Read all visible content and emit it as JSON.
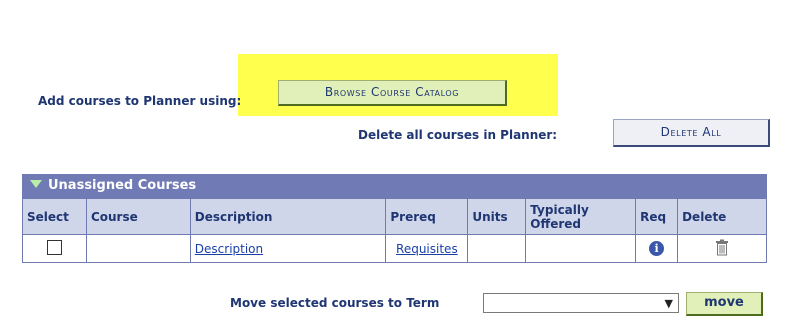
{
  "add_label": "Add courses to Planner using:",
  "browse_button": "Browse Course Catalog",
  "delete_label": "Delete all courses in Planner:",
  "delete_all_button": "Delete All",
  "grid": {
    "title": "Unassigned Courses",
    "columns": [
      "Select",
      "Course",
      "Description",
      "Prereq",
      "Units",
      "Typically Offered",
      "Req",
      "Delete"
    ],
    "rows": [
      {
        "select": false,
        "course": "",
        "description": "Description",
        "prereq": "Requisites",
        "units": "",
        "typically_offered": "",
        "req_icon": "info-icon",
        "delete_icon": "trash-icon"
      }
    ]
  },
  "move_label": "Move selected courses to Term",
  "term_select_value": "",
  "move_button": "move",
  "colors": {
    "highlight": "#ffff4d",
    "grid_header": "#707ab4",
    "button_green": "#e1f0b8"
  }
}
